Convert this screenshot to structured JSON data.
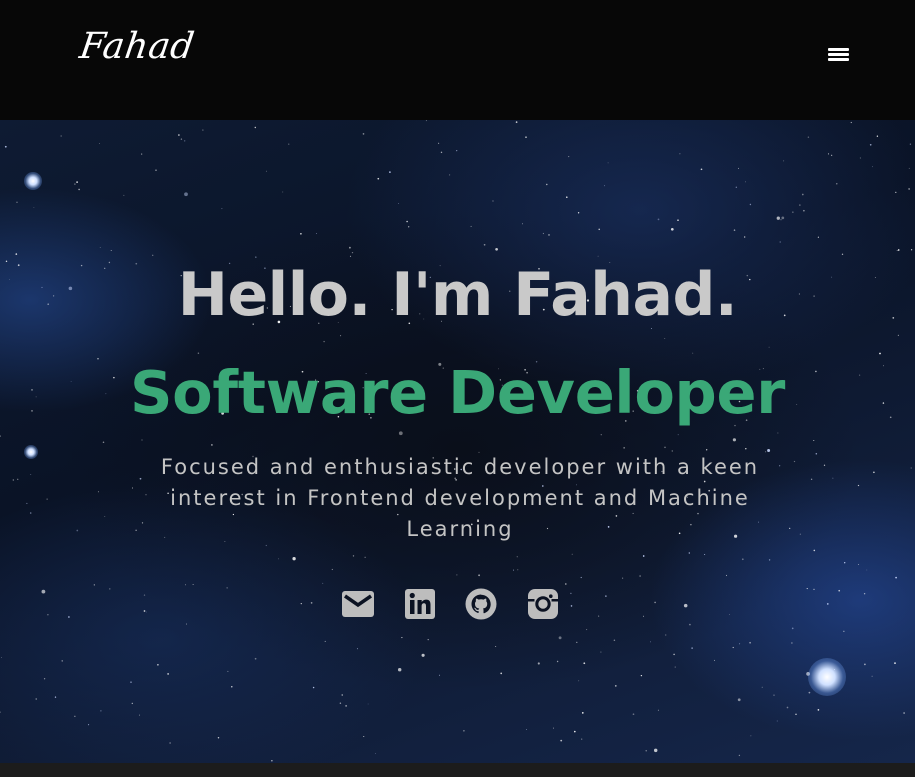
{
  "nav": {
    "logo": "Fahad",
    "menu_icon": "hamburger-menu-icon"
  },
  "hero": {
    "greeting": "Hello. I'm Fahad.",
    "role": "Software Developer",
    "tagline": "Focused and enthusiastic developer with a keen interest in Frontend development and Machine Learning",
    "socials": [
      {
        "icon": "mail-icon"
      },
      {
        "icon": "linkedin-icon"
      },
      {
        "icon": "github-icon"
      },
      {
        "icon": "instagram-icon"
      }
    ]
  },
  "colors": {
    "background": "#070707",
    "accent_green": "#3aa877",
    "text_grey": "#c9c9c9",
    "icon_grey": "#bdbdbd"
  }
}
